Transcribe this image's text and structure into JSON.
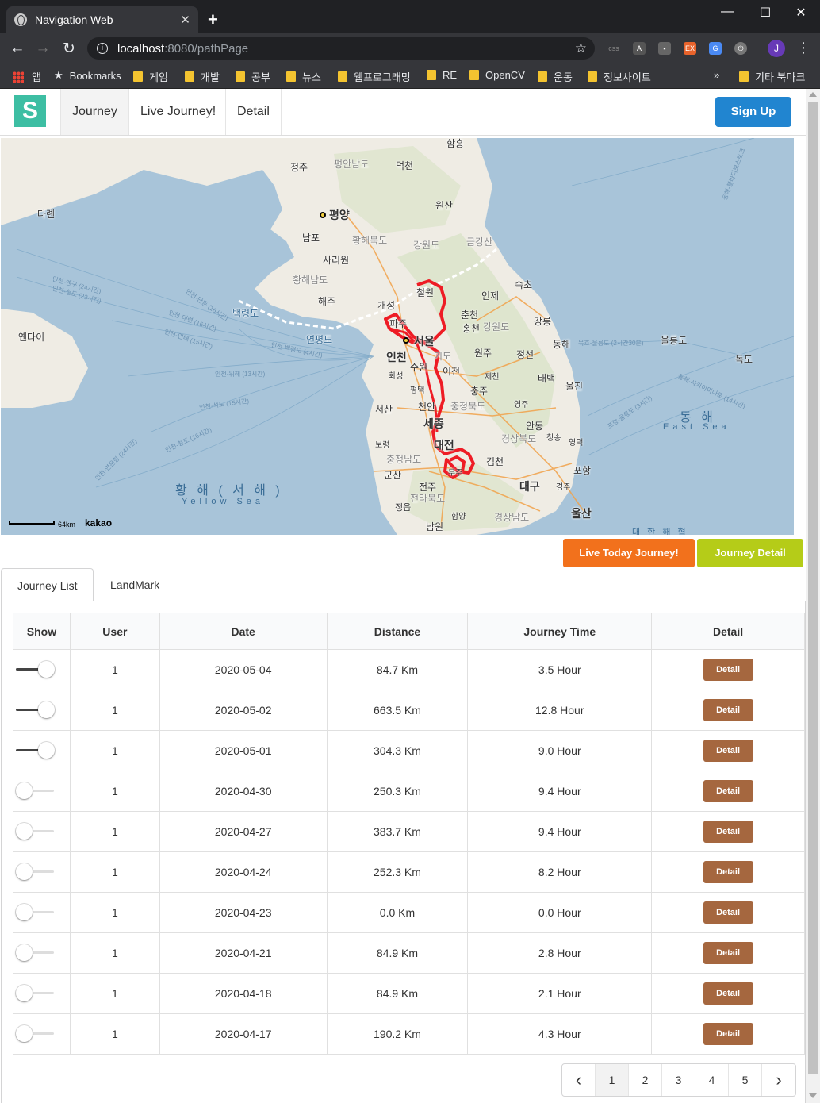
{
  "browser": {
    "tab_title": "Navigation Web",
    "url_host": "localhost",
    "url_rest": ":8080/pathPage",
    "bookmarks": [
      "앱",
      "Bookmarks",
      "게임",
      "개발",
      "공부",
      "뉴스",
      "웹프로그래밍",
      "RE",
      "OpenCV",
      "운동",
      "정보사이트"
    ],
    "bookmarks_overflow": "»",
    "other_bookmarks": "기타 북마크",
    "profile_initial": "J"
  },
  "navbar": {
    "logo": "S",
    "links": [
      "Journey",
      "Live Journey!",
      "Detail"
    ],
    "signup_label": "Sign Up"
  },
  "map": {
    "attribution": "kakao",
    "scale": "64km",
    "labels": {
      "hamheung": "함흥",
      "jeongju": "정주",
      "pyeongan": "평안남도",
      "deokcheon": "덕천",
      "dahlen": "다롄",
      "pyongyang": "평양",
      "wonsan": "원산",
      "nampo": "남포",
      "hwanghaebuk": "황해북도",
      "gangwon_n": "강원도",
      "geumgangsan": "금강산",
      "sariwon": "사리원",
      "hwanghaenam": "황해남도",
      "sokcho": "속초",
      "cheorwon": "철원",
      "inje": "인제",
      "haeju": "해주",
      "kaesong": "개성",
      "baengnyeong": "백령도",
      "chuncheon": "춘천",
      "gangneung": "강릉",
      "paju": "파주",
      "hongcheon": "홍천",
      "gangwon_s": "강원도",
      "yantai": "옌타이",
      "yeonpyeong": "연평도",
      "seoul": "서울",
      "incheon": "인천",
      "gyeonggi": "기도",
      "wonju": "원주",
      "jeongseon": "정선",
      "donghae": "동해",
      "ulleungdo": "울릉도",
      "dokdo": "독도",
      "suwon": "수원",
      "hwaseong": "화성",
      "icheon": "이천",
      "jecheon": "제천",
      "taebaek": "태백",
      "pyeongtaek": "평택",
      "chungju": "충주",
      "uljin": "울진",
      "seosan": "서산",
      "cheonan": "천안",
      "chungbuk": "충청북도",
      "yeongju": "영주",
      "sejong": "세종",
      "andong": "안동",
      "gyeongbuk": "경상북도",
      "cheongsong": "청송",
      "yeongdeok": "영덕",
      "boryeong": "보령",
      "daejeon": "대전",
      "gimcheon": "김천",
      "chungnam": "충청남도",
      "pohang": "포항",
      "gunsan": "군산",
      "daegu": "대구",
      "gyeongju": "경주",
      "jeonju": "전주",
      "jeonbuk": "전라북도",
      "jeongeup": "정읍",
      "hamyang": "함양",
      "gyeongnam": "경상남도",
      "ulsan": "울산",
      "namwon": "남원",
      "muju": "무주",
      "east_sea": "동 해",
      "east_sea_en": "East Sea",
      "yellow_sea": "황 해 ( 서 해 )",
      "yellow_sea_en": "Yellow Sea",
      "south_sea": "대 한 해 협",
      "route_1": "인천-옌구 (24시간)",
      "route_2": "인천-청도 (23시간)",
      "route_3": "인천-연운항 (24시간)",
      "route_4": "인천-단동 (16시간)",
      "route_5": "인천-대련 (16시간)",
      "route_6": "인천-연태 (15시간)",
      "route_7": "인천-위해 (13시간)",
      "route_8": "인천-석도 (15시간)",
      "route_9": "인천-청도 (16시간)",
      "route_10": "인천-연운항 (24시간)",
      "route_11": "인천-백령도 (4시간)",
      "route_12": "묵호-울릉도 (2시간30분)",
      "route_13": "동해-블라디보스토크",
      "route_14": "동해-사카이미나토 (14시간)",
      "route_15": "포항-울릉도 (3시간)"
    }
  },
  "actions": {
    "live_today": "Live Today Journey!",
    "journey_detail": "Journey Detail"
  },
  "tabs": [
    "Journey List",
    "LandMark"
  ],
  "table": {
    "headers": [
      "Show",
      "User",
      "Date",
      "Distance",
      "Journey Time",
      "Detail"
    ],
    "detail_label": "Detail",
    "rows": [
      {
        "show": true,
        "user": "1",
        "date": "2020-05-04",
        "distance": "84.7 Km",
        "time": "3.5 Hour"
      },
      {
        "show": true,
        "user": "1",
        "date": "2020-05-02",
        "distance": "663.5 Km",
        "time": "12.8 Hour"
      },
      {
        "show": true,
        "user": "1",
        "date": "2020-05-01",
        "distance": "304.3 Km",
        "time": "9.0 Hour"
      },
      {
        "show": false,
        "user": "1",
        "date": "2020-04-30",
        "distance": "250.3 Km",
        "time": "9.4 Hour"
      },
      {
        "show": false,
        "user": "1",
        "date": "2020-04-27",
        "distance": "383.7 Km",
        "time": "9.4 Hour"
      },
      {
        "show": false,
        "user": "1",
        "date": "2020-04-24",
        "distance": "252.3 Km",
        "time": "8.2 Hour"
      },
      {
        "show": false,
        "user": "1",
        "date": "2020-04-23",
        "distance": "0.0 Km",
        "time": "0.0 Hour"
      },
      {
        "show": false,
        "user": "1",
        "date": "2020-04-21",
        "distance": "84.9 Km",
        "time": "2.8 Hour"
      },
      {
        "show": false,
        "user": "1",
        "date": "2020-04-18",
        "distance": "84.9 Km",
        "time": "2.1 Hour"
      },
      {
        "show": false,
        "user": "1",
        "date": "2020-04-17",
        "distance": "190.2 Km",
        "time": "4.3 Hour"
      }
    ]
  },
  "pagination": {
    "prev": "‹",
    "pages": [
      "1",
      "2",
      "3",
      "4",
      "5"
    ],
    "active_page": "1",
    "next": "›"
  },
  "colors": {
    "logo_bg": "#3dbea3",
    "signup_bg": "#2185d0",
    "live_btn_bg": "#f2711c",
    "detail_btn_bg": "#b5cc18",
    "row_detail_bg": "#a5673f",
    "route_line": "#ee1c25"
  }
}
